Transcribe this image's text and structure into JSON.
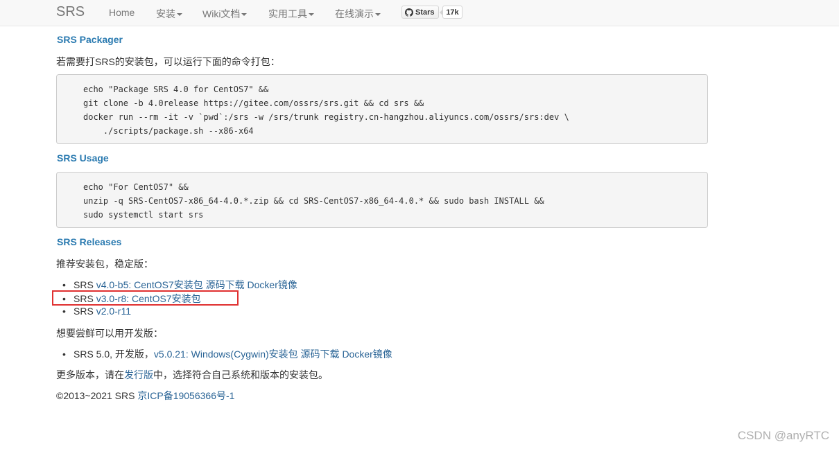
{
  "navbar": {
    "brand": "SRS",
    "items": [
      {
        "label": "Home",
        "dropdown": false
      },
      {
        "label": "安装",
        "dropdown": true
      },
      {
        "label": "Wiki文档",
        "dropdown": true
      },
      {
        "label": "实用工具",
        "dropdown": true
      },
      {
        "label": "在线演示",
        "dropdown": true
      }
    ],
    "github": {
      "stars_label": "Stars",
      "count": "17k"
    }
  },
  "packager": {
    "heading": "SRS Packager",
    "intro": "若需要打SRS的安装包，可以运行下面的命令打包：",
    "code": [
      "echo \"Package SRS 4.0 for CentOS7\" &&",
      "git clone -b 4.0release https://gitee.com/ossrs/srs.git && cd srs &&",
      "docker run --rm -it -v `pwd`:/srs -w /srs/trunk registry.cn-hangzhou.aliyuncs.com/ossrs/srs:dev \\",
      "    ./scripts/package.sh --x86-x64"
    ]
  },
  "usage": {
    "heading": "SRS Usage",
    "code": [
      "echo \"For CentOS7\" &&",
      "unzip -q SRS-CentOS7-x86_64-4.0.*.zip && cd SRS-CentOS7-x86_64-4.0.* && sudo bash INSTALL &&",
      "sudo systemctl start srs"
    ]
  },
  "releases": {
    "heading": "SRS Releases",
    "stable_intro": "推荐安装包，稳定版：",
    "stable": [
      {
        "prefix": "SRS ",
        "version": "v4.0-b5: CentOS7安装包",
        "source": "源码下载",
        "docker": "Docker镜像"
      },
      {
        "prefix": "SRS ",
        "version": "v3.0-r8: CentOS7安装包",
        "source": "",
        "docker": ""
      },
      {
        "prefix": "SRS ",
        "version": "v2.0-r11",
        "source": "",
        "docker": ""
      }
    ],
    "dev_intro": "想要尝鲜可以用开发版：",
    "dev": {
      "prefix": "SRS 5.0, 开发版，",
      "version": "v5.0.21: Windows(Cygwin)安装包",
      "source": "源码下载",
      "docker": "Docker镜像"
    },
    "more_prefix": "更多版本，请在",
    "more_link": "发行版",
    "more_suffix": "中，选择符合自己系统和版本的安装包。"
  },
  "footer": {
    "copyright": "©2013~2021 SRS ",
    "icp": "京ICP备19056366号-1"
  },
  "watermark": "CSDN @anyRTC",
  "colors": {
    "link": "#2a6496",
    "heading": "#2a7ab0",
    "highlight": "#e03030"
  }
}
